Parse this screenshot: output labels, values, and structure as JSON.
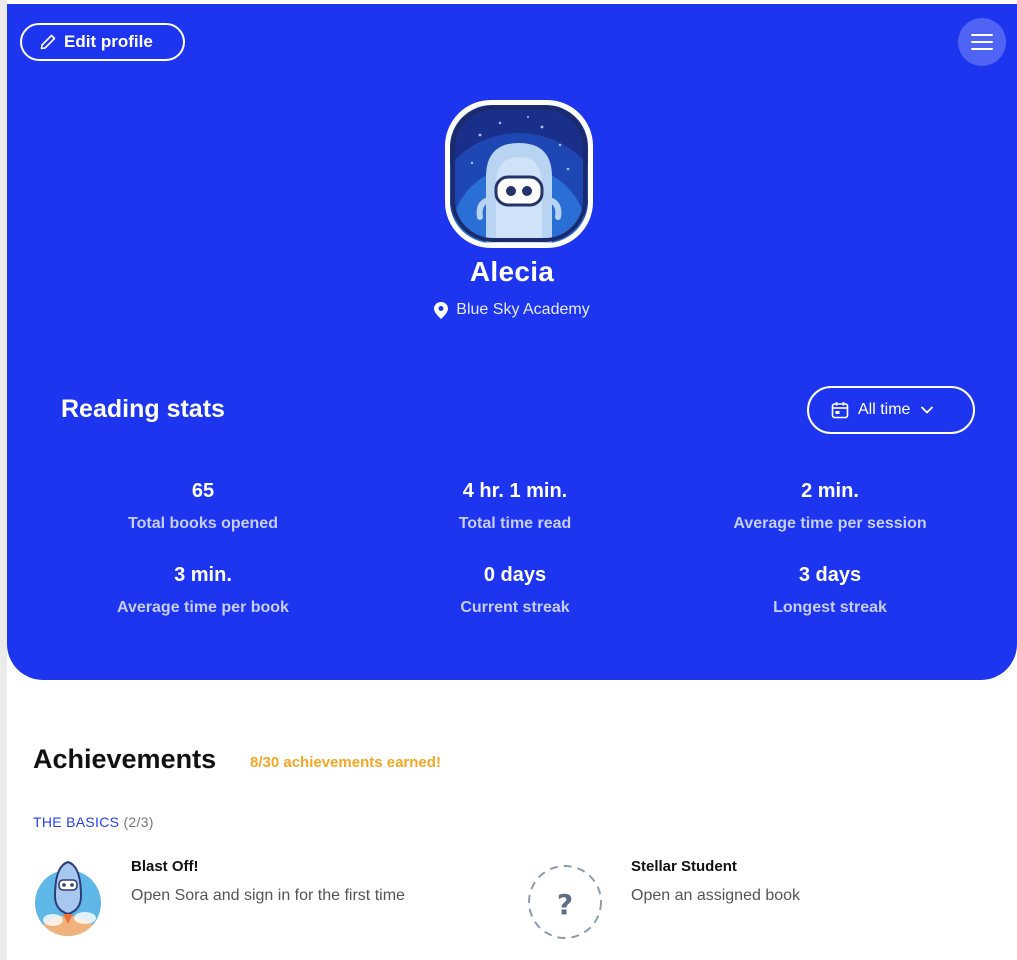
{
  "header": {
    "edit_profile_label": "Edit profile"
  },
  "profile": {
    "name": "Alecia",
    "school": "Blue Sky Academy"
  },
  "reading_stats": {
    "title": "Reading stats",
    "range_label": "All time",
    "stats": [
      {
        "value": "65",
        "label": "Total books opened"
      },
      {
        "value": "4 hr. 1 min.",
        "label": "Total time read"
      },
      {
        "value": "2 min.",
        "label": "Average time per session"
      },
      {
        "value": "3 min.",
        "label": "Average time per book"
      },
      {
        "value": "0 days",
        "label": "Current streak"
      },
      {
        "value": "3 days",
        "label": "Longest streak"
      }
    ]
  },
  "achievements": {
    "title": "Achievements",
    "earned_text": "8/30 achievements earned!",
    "category": {
      "title": "THE BASICS",
      "count": "(2/3)"
    },
    "items": [
      {
        "name": "Blast Off!",
        "description": "Open Sora and sign in for the first time",
        "earned": true
      },
      {
        "name": "Stellar Student",
        "description": "Open an assigned book",
        "earned": false
      }
    ]
  },
  "colors": {
    "hero_bg": "#1e35f0",
    "accent_orange": "#f5a623",
    "category_blue": "#2540f0"
  },
  "icons": {
    "edit": "pencil-icon",
    "menu": "hamburger-menu-icon",
    "location": "map-pin-icon",
    "calendar": "calendar-icon",
    "dropdown": "chevron-down-icon",
    "locked_achievement": "question-mark-icon"
  }
}
